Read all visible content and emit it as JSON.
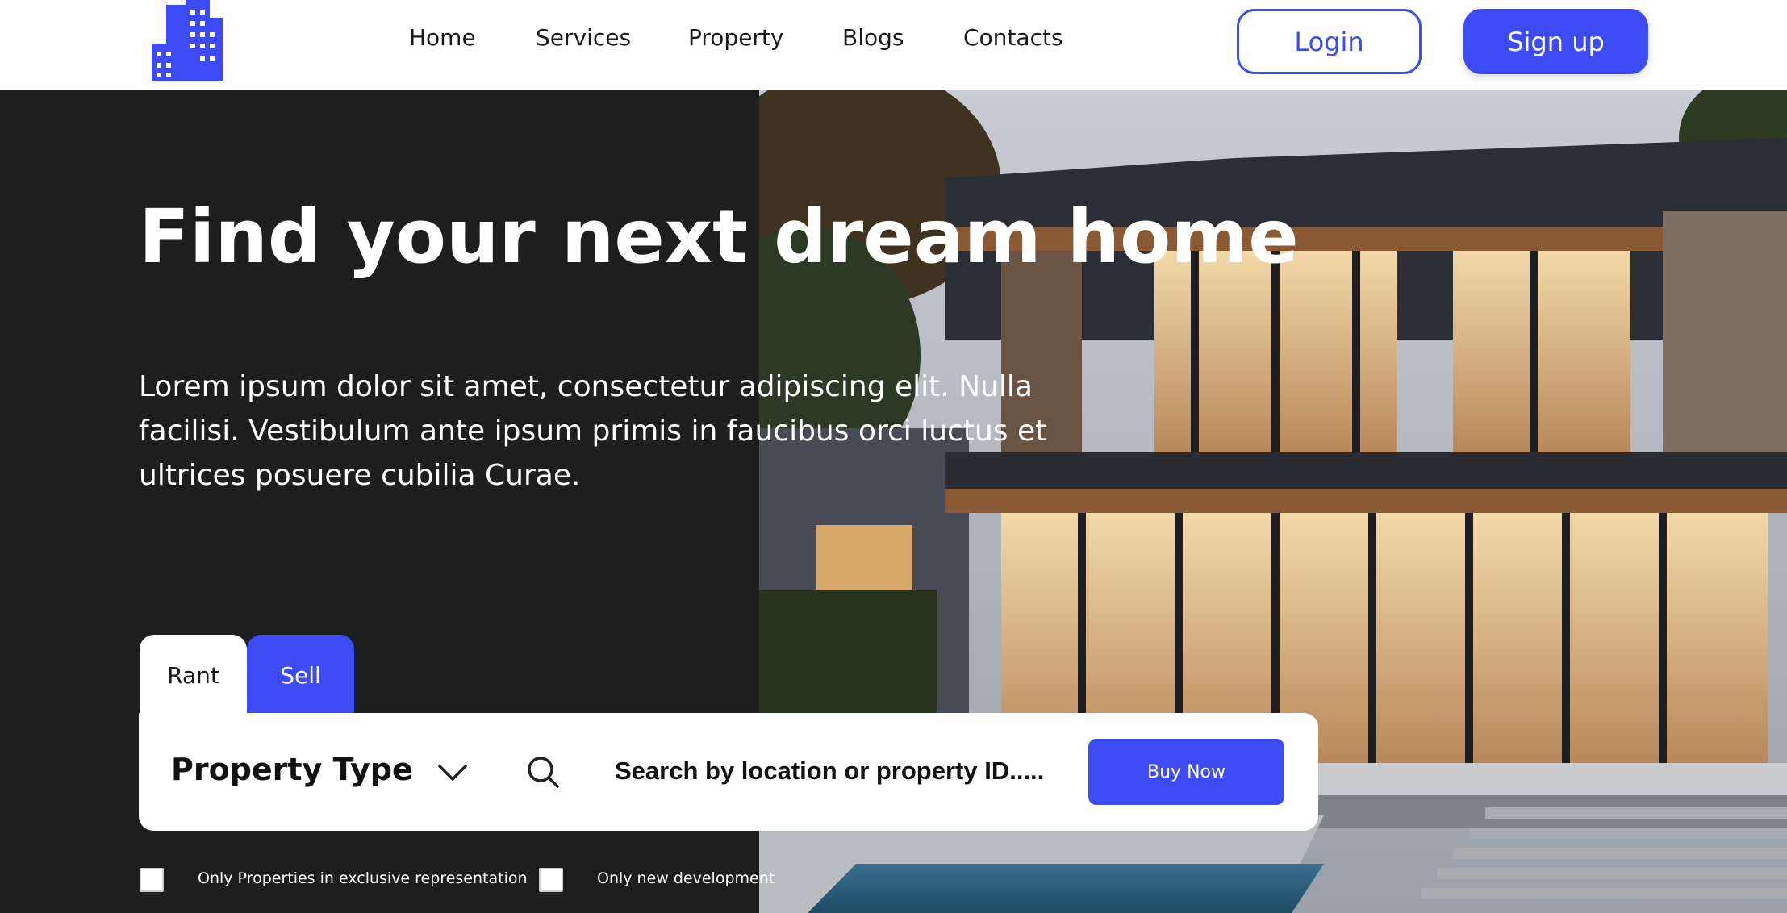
{
  "nav": {
    "items": [
      {
        "label": "Home"
      },
      {
        "label": "Services"
      },
      {
        "label": "Property"
      },
      {
        "label": "Blogs"
      },
      {
        "label": "Contacts"
      }
    ],
    "login_label": "Login",
    "signup_label": "Sign up"
  },
  "hero": {
    "title": "Find your next dream home",
    "text": "Lorem ipsum dolor sit amet, consectetur adipiscing elit. Nulla facilisi. Vestibulum ante ipsum primis in faucibus orci luctus et ultrices posuere cubilia Curae."
  },
  "tabs": [
    {
      "label": "Rant"
    },
    {
      "label": "Sell"
    }
  ],
  "search": {
    "property_type_label": "Property Type",
    "placeholder": "Search by location or property ID.....",
    "buy_label": "Buy Now"
  },
  "filters": [
    {
      "label": "Only Properties in exclusive representation"
    },
    {
      "label": "Only new development"
    }
  ],
  "colors": {
    "accent": "#3d4bf5",
    "dark_bg": "#1e1e1f"
  },
  "icons": {
    "logo": "building-icon",
    "dropdown": "chevron-down-icon",
    "search": "search-icon"
  }
}
